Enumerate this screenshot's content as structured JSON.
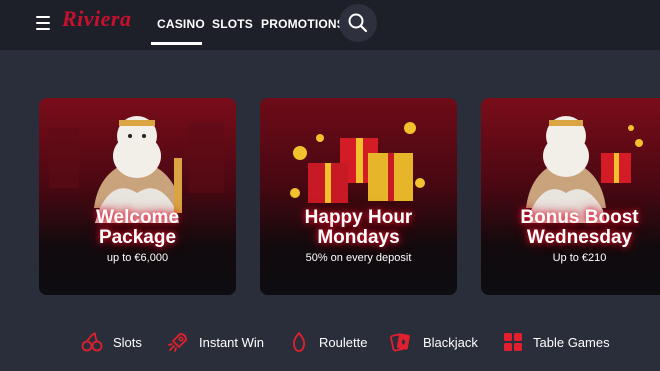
{
  "header": {
    "logo_text": "Riviera",
    "nav": [
      {
        "label": "CASINO",
        "active": true
      },
      {
        "label": "SLOTS"
      },
      {
        "label": "PROMOTIONS"
      }
    ]
  },
  "promos": [
    {
      "title_line1": "Welcome",
      "title_line2": "Package",
      "subtitle": "up to €6,000"
    },
    {
      "title_line1": "Happy Hour",
      "title_line2": "Mondays",
      "subtitle": "50% on every deposit"
    },
    {
      "title_line1": "Bonus Boost",
      "title_line2": "Wednesday",
      "subtitle": "Up to €210"
    }
  ],
  "categories": [
    {
      "label": "Slots",
      "icon": "cherries-icon"
    },
    {
      "label": "Instant Win",
      "icon": "rocket-icon"
    },
    {
      "label": "Roulette",
      "icon": "flame-icon"
    },
    {
      "label": "Blackjack",
      "icon": "cards-icon"
    },
    {
      "label": "Table Games",
      "icon": "grid-icon"
    }
  ],
  "colors": {
    "accent": "#c8102e",
    "background": "#2a2d3a",
    "header": "#1e2029",
    "card": "#101116"
  }
}
